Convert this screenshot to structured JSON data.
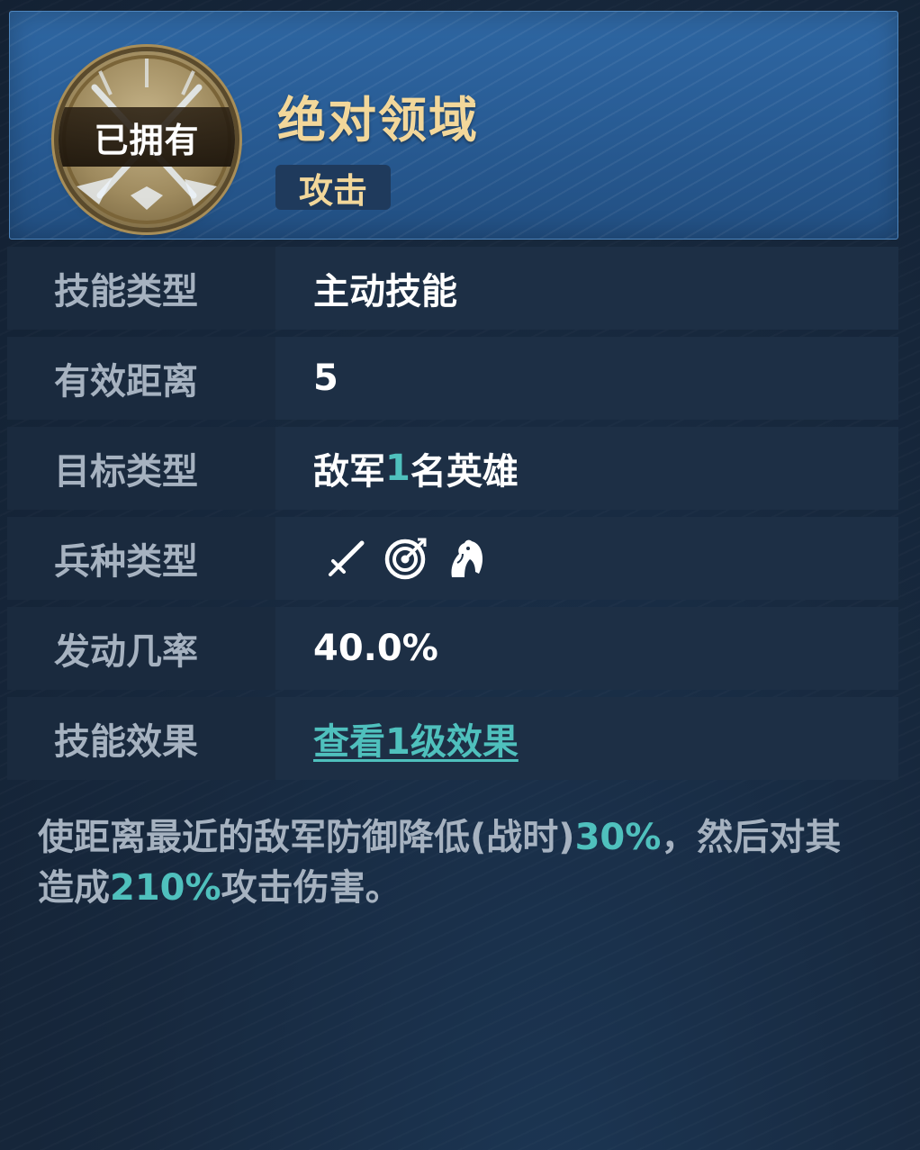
{
  "skill": {
    "owned_label": "已拥有",
    "name": "绝对领域",
    "tag": "攻击"
  },
  "attributes": {
    "skill_type": {
      "label": "技能类型",
      "value": "主动技能"
    },
    "range": {
      "label": "有效距离",
      "value": "5"
    },
    "target": {
      "label": "目标类型",
      "value_prefix": "敌军",
      "value_count": "1",
      "value_suffix": "名英雄"
    },
    "troops": {
      "label": "兵种类型",
      "icons": [
        "sword-icon",
        "archery-target-icon",
        "horse-icon"
      ]
    },
    "rate": {
      "label": "发动几率",
      "value": "40.0%"
    },
    "effect": {
      "label": "技能效果",
      "link": "查看1级效果"
    }
  },
  "description": {
    "part1": "使距离最近的敌军防御降低(战时)",
    "value1": "30%",
    "part2": "，然后对其造成",
    "value2": "210%",
    "part3": "攻击伤害。"
  },
  "colors": {
    "accent_teal": "#4fc0bd",
    "title_gold": "#f2d79a",
    "header_blue": "#2f67a3"
  }
}
